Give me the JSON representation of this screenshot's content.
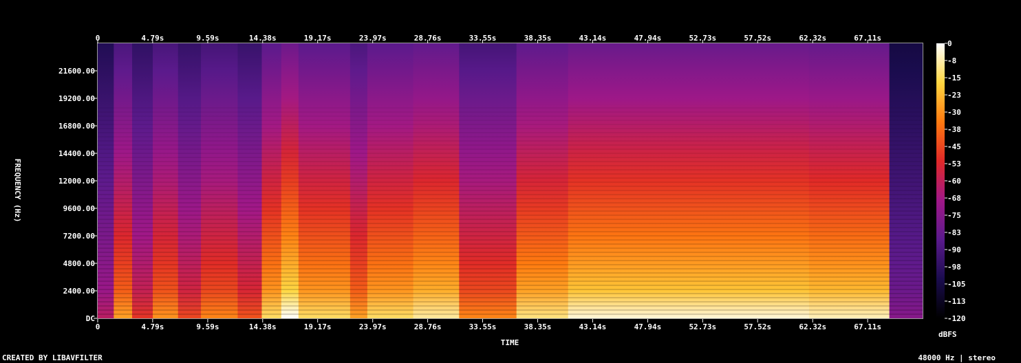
{
  "chart_data": {
    "type": "heatmap",
    "title": "",
    "xlabel": "TIME",
    "ylabel": "FREQUENCY (Hz)",
    "x_ticks": [
      "0",
      "4.79s",
      "9.59s",
      "14.38s",
      "19.17s",
      "23.97s",
      "28.76s",
      "33.55s",
      "38.35s",
      "43.14s",
      "47.94s",
      "52.73s",
      "57.52s",
      "62.32s",
      "67.11s"
    ],
    "x_tick_seconds": [
      0,
      4.79,
      9.59,
      14.38,
      19.17,
      23.97,
      28.76,
      33.55,
      38.35,
      43.14,
      47.94,
      52.73,
      57.52,
      62.32,
      67.11
    ],
    "xlim": [
      0,
      71.9
    ],
    "y_ticks": [
      "DC",
      "2400.00",
      "4800.00",
      "7200.00",
      "9600.00",
      "12000.00",
      "14400.00",
      "16800.00",
      "19200.00",
      "21600.00"
    ],
    "y_tick_hz": [
      0,
      2400,
      4800,
      7200,
      9600,
      12000,
      14400,
      16800,
      19200,
      21600
    ],
    "ylim": [
      0,
      24000
    ],
    "colorbar": {
      "label": "dBFS",
      "ticks": [
        "0",
        "-8",
        "-15",
        "-23",
        "-30",
        "-38",
        "-45",
        "-53",
        "-60",
        "-68",
        "-75",
        "-83",
        "-90",
        "-98",
        "-105",
        "-113",
        "-120"
      ],
      "range": [
        -120,
        0
      ],
      "colors": [
        "#000000",
        "#1a0c4e",
        "#5a1a8c",
        "#a01888",
        "#e02828",
        "#ff7a10",
        "#ffd640",
        "#ffffff"
      ]
    },
    "segments_seconds": [
      {
        "start": 0.0,
        "end": 1.4,
        "level": 0.45
      },
      {
        "start": 1.4,
        "end": 3.0,
        "level": 0.72
      },
      {
        "start": 3.0,
        "end": 4.8,
        "level": 0.55
      },
      {
        "start": 4.8,
        "end": 7.0,
        "level": 0.7
      },
      {
        "start": 7.0,
        "end": 9.0,
        "level": 0.58
      },
      {
        "start": 9.0,
        "end": 12.2,
        "level": 0.68
      },
      {
        "start": 12.2,
        "end": 14.3,
        "level": 0.6
      },
      {
        "start": 14.3,
        "end": 16.0,
        "level": 0.82
      },
      {
        "start": 16.0,
        "end": 17.5,
        "level": 0.93
      },
      {
        "start": 17.5,
        "end": 22.0,
        "level": 0.82
      },
      {
        "start": 22.0,
        "end": 23.5,
        "level": 0.72
      },
      {
        "start": 23.5,
        "end": 27.5,
        "level": 0.82
      },
      {
        "start": 27.5,
        "end": 31.5,
        "level": 0.86
      },
      {
        "start": 31.5,
        "end": 36.5,
        "level": 0.68
      },
      {
        "start": 36.5,
        "end": 41.0,
        "level": 0.84
      },
      {
        "start": 41.0,
        "end": 45.0,
        "level": 0.9
      },
      {
        "start": 45.0,
        "end": 57.0,
        "level": 0.9
      },
      {
        "start": 57.0,
        "end": 62.0,
        "level": 0.9
      },
      {
        "start": 62.0,
        "end": 69.0,
        "level": 0.88
      },
      {
        "start": 69.0,
        "end": 71.9,
        "level": 0.35
      }
    ]
  },
  "footer": {
    "left": "CREATED BY LIBAVFILTER",
    "right": "48000 Hz | stereo"
  }
}
